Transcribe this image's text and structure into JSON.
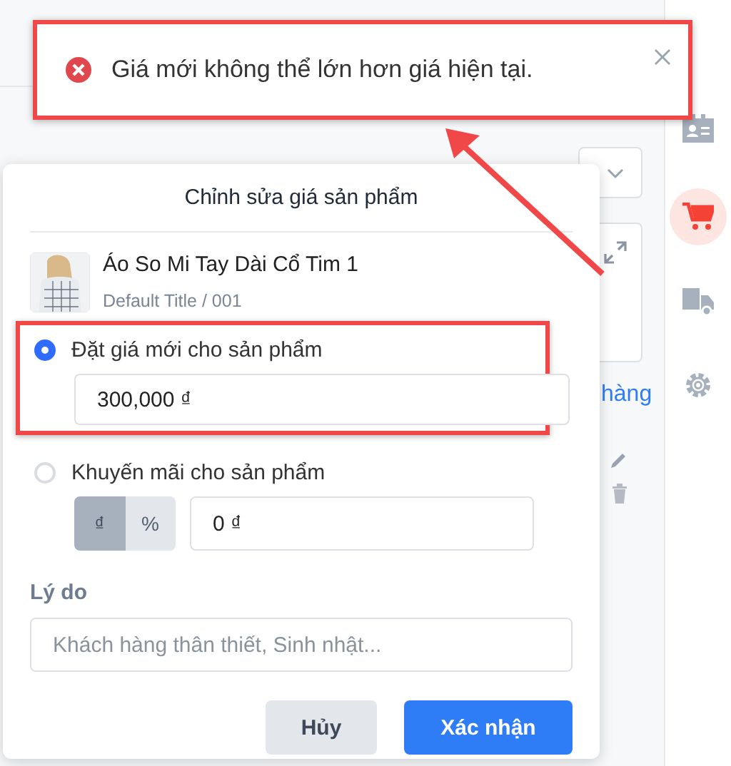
{
  "background": {
    "link_text": "hàng"
  },
  "sidebar": {
    "items": [
      {
        "kind": "contact",
        "selected": false
      },
      {
        "kind": "cart",
        "selected": true
      },
      {
        "kind": "truck",
        "selected": false
      },
      {
        "kind": "gear",
        "selected": false
      }
    ]
  },
  "toast": {
    "kind": "error",
    "message": "Giá mới không thể lớn hơn giá hiện tại.",
    "highlighted": true,
    "arrow": true
  },
  "dialog": {
    "title": "Chỉnh sửa giá sản phẩm",
    "product": {
      "name": "Áo So Mi Tay Dài Cổ Tim 1",
      "variant": "Default Title / 001"
    },
    "options": [
      {
        "kind": "price",
        "label": "Đặt giá mới cho sản phẩm",
        "selected": true,
        "highlighted": true,
        "value": "300,000 ₫"
      },
      {
        "kind": "discount",
        "label": "Khuyến mãi cho sản phẩm",
        "selected": false,
        "highlighted": false,
        "units": [
          {
            "label": "₫",
            "selected": true
          },
          {
            "label": "%",
            "selected": false
          }
        ],
        "value": "0 ₫"
      }
    ],
    "reason": {
      "label": "Lý do",
      "placeholder": "Khách hàng thân thiết, Sinh nhật..."
    },
    "buttons": [
      {
        "kind": "secondary",
        "label": "Hủy"
      },
      {
        "kind": "primary",
        "label": "Xác nhận"
      }
    ]
  }
}
